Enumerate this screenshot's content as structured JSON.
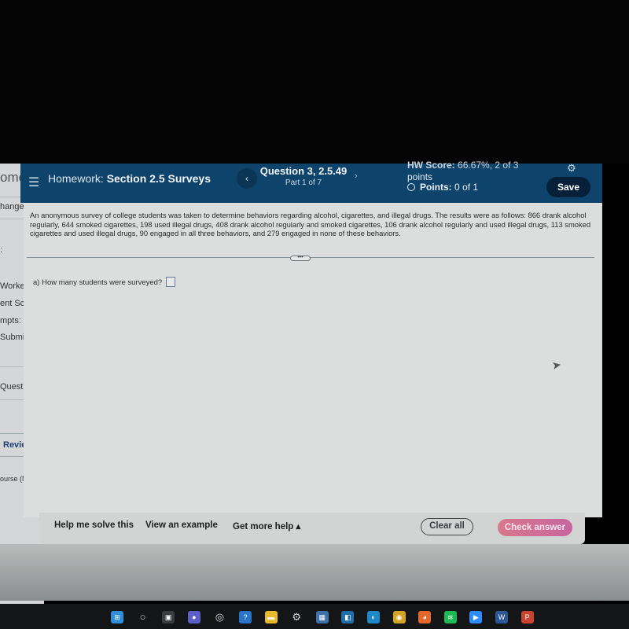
{
  "sidebar": {
    "home_fragment": "ome",
    "items": [
      {
        "label": "hange"
      },
      {
        "label": ":"
      },
      {
        "label": "Worked"
      },
      {
        "label": "ent Sco"
      },
      {
        "label": "mpts:"
      },
      {
        "label": "Submis"
      },
      {
        "label": "Question"
      },
      {
        "label": "Review"
      },
      {
        "label": "ourse (MGF"
      }
    ]
  },
  "header": {
    "menu_icon": "hamburger-menu-icon",
    "homework_prefix": "Homework:",
    "homework_title": "Section 2.5 Surveys",
    "prev_glyph": "‹",
    "question_title": "Question 3, 2.5.49",
    "question_part": "Part 1 of 7",
    "next_glyph": "›",
    "hw_score_label": "HW Score:",
    "hw_score_value": "66.67%, 2 of 3",
    "hw_score_unit": "points",
    "points_label": "Points:",
    "points_value": "0 of 1",
    "gear_glyph": "⚙",
    "save_label": "Save"
  },
  "problem": {
    "text": "An anonymous survey of college students was taken to determine behaviors regarding alcohol, cigarettes, and illegal drugs.  The results were as follows: 866 drank alcohol regularly, 644 smoked cigarettes, 198 used illegal drugs, 408 drank alcohol regularly and smoked cigarettes, 106 drank alcohol regularly and used illegal drugs, 113 smoked cigarettes and used illegal drugs, 90 engaged in all three behaviors, and 279 engaged in none of these behaviors.",
    "expand_glyph": "•••",
    "question_label": "a) How many students were surveyed?",
    "answer_value": ""
  },
  "footer": {
    "help_me_solve": "Help me solve this",
    "view_example": "View an example",
    "get_more_help": "Get more help ▴",
    "clear_all": "Clear all",
    "check_answer": "Check answer"
  },
  "colors": {
    "header_bg": "#0e436b",
    "save_bg": "#07203a",
    "check_answer_bg": "#d06e96",
    "content_bg": "#dcdedd"
  },
  "taskbar": {
    "icons": [
      {
        "name": "windows-start-icon",
        "glyph": "⊞",
        "color": "#2f8fd8"
      },
      {
        "name": "search-icon",
        "glyph": "○",
        "color": "transparent"
      },
      {
        "name": "task-view-icon",
        "glyph": "▣",
        "color": "#3a3d40"
      },
      {
        "name": "teams-chat-icon",
        "glyph": "●",
        "color": "#5b5fc7"
      },
      {
        "name": "copilot-icon",
        "glyph": "◎",
        "color": "transparent"
      },
      {
        "name": "help-icon",
        "glyph": "?",
        "color": "#2a74c7"
      },
      {
        "name": "file-explorer-icon",
        "glyph": "▬",
        "color": "#e6b92e"
      },
      {
        "name": "settings-icon",
        "glyph": "⚙",
        "color": "transparent"
      },
      {
        "name": "store-icon",
        "glyph": "▦",
        "color": "#3f6fa8"
      },
      {
        "name": "photos-icon",
        "glyph": "◧",
        "color": "#1f6fa8"
      },
      {
        "name": "edge-icon",
        "glyph": "◐",
        "color": "#1d8ac7"
      },
      {
        "name": "chrome-icon",
        "glyph": "◉",
        "color": "#d4a525"
      },
      {
        "name": "firefox-icon",
        "glyph": "◕",
        "color": "#e2692b"
      },
      {
        "name": "spotify-icon",
        "glyph": "≋",
        "color": "#1db954"
      },
      {
        "name": "zoom-icon",
        "glyph": "▶",
        "color": "#2d8cff"
      },
      {
        "name": "word-icon",
        "glyph": "W",
        "color": "#2b5797"
      },
      {
        "name": "powerpoint-icon",
        "glyph": "P",
        "color": "#c9432e"
      }
    ]
  }
}
